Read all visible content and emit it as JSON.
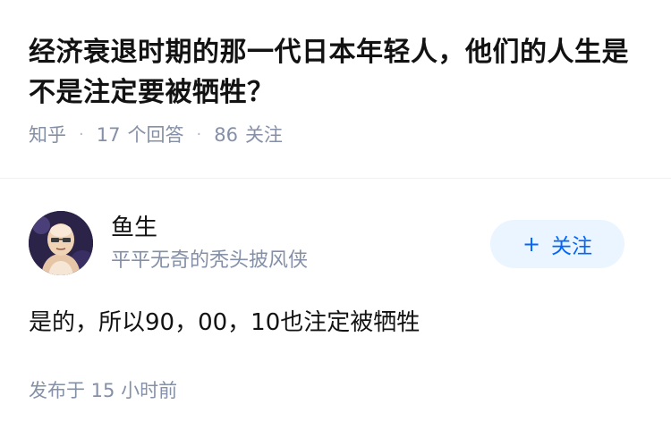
{
  "question": {
    "title": "经济衰退时期的那一代日本年轻人，他们的人生是不是注定要被牺牲？",
    "source": "知乎",
    "answers_count": "17",
    "answers_label": "个回答",
    "followers_count": "86",
    "followers_label": "关注"
  },
  "author": {
    "name": "鱼生",
    "headline": "平平无奇的秃头披风侠",
    "avatar_icon": "bald-hero-avatar",
    "follow_plus": "+",
    "follow_label": "关注"
  },
  "answer": {
    "content": "是的，所以90，00，10也注定被牺牲",
    "time": "发布于 15 小时前"
  },
  "colors": {
    "title_text": "#121212",
    "meta_gray": "#8590a6",
    "follow_bg": "#ebf5ff",
    "follow_text": "#0066ff",
    "divider": "#f0f2f7"
  }
}
